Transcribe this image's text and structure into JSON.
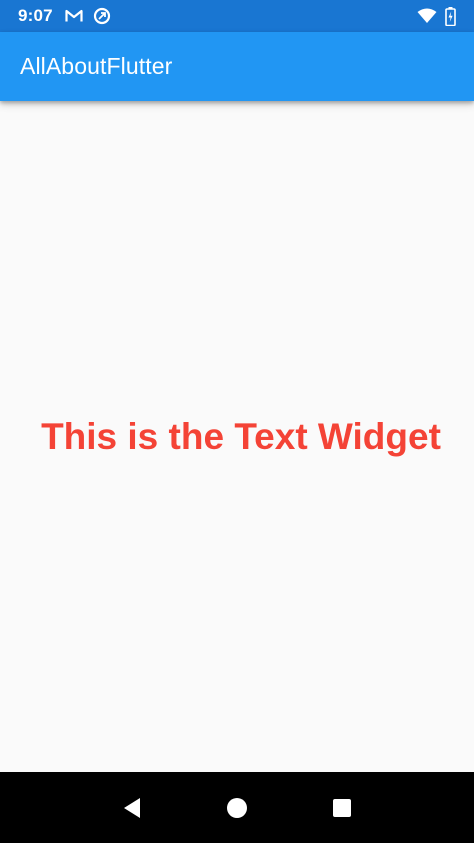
{
  "status_bar": {
    "time": "9:07",
    "left_icons": [
      "gmail-icon",
      "data-saver-icon"
    ],
    "right_icons": [
      "wifi-icon",
      "battery-charging-icon"
    ]
  },
  "app_bar": {
    "title": "AllAboutFlutter"
  },
  "body": {
    "text": "This is the Text Widget"
  },
  "nav_bar": {
    "buttons": [
      "back-icon",
      "home-icon",
      "recents-icon"
    ]
  },
  "colors": {
    "status_bar": "#1976d2",
    "app_bar": "#2196f3",
    "background": "#fafafa",
    "text_widget": "#f44336",
    "nav_bar": "#000000"
  }
}
